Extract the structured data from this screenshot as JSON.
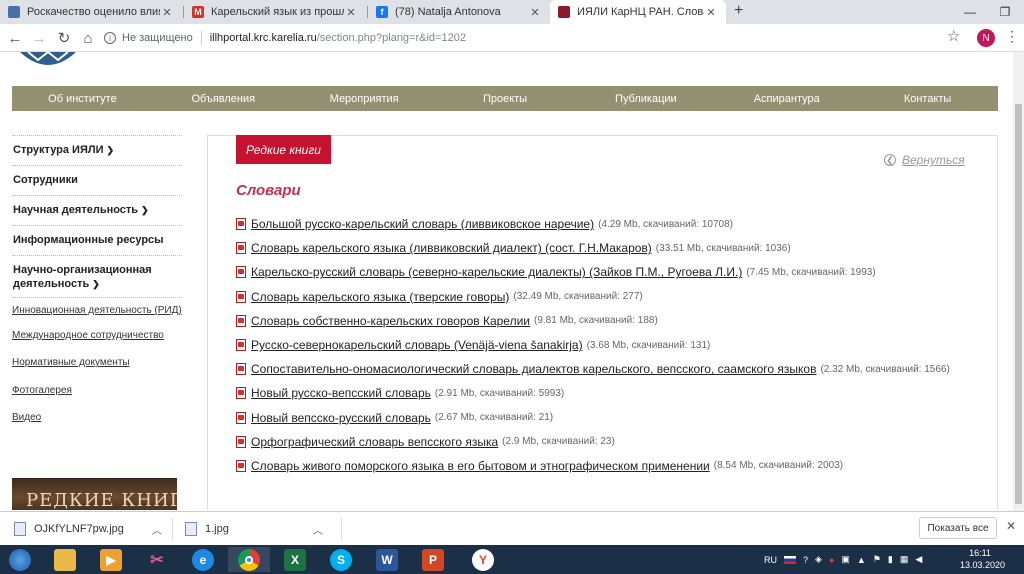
{
  "tabs": [
    {
      "title": "Роскачество оценило влияние",
      "favicon_color": "#4a6fa5",
      "active": false
    },
    {
      "title": "Карельский язык из прошлого",
      "favicon_color": "#d93025",
      "active": false
    },
    {
      "title": "(78) Natalja Antonova",
      "favicon_color": "#1877f2",
      "active": false
    },
    {
      "title": "ИЯЛИ КарНЦ РАН. Словари",
      "favicon_color": "#8b1a2c",
      "active": true
    }
  ],
  "address": {
    "security": "Не защищено",
    "domain": "illhportal.krc.karelia.ru",
    "path": "/section.php?plang=r&id=1202"
  },
  "profile_initial": "N",
  "main_nav": [
    "Об институте",
    "Объявления",
    "Мероприятия",
    "Проекты",
    "Публикации",
    "Аспирантура",
    "Контакты"
  ],
  "sidebar": {
    "main": [
      {
        "label": "Структура ИЯЛИ",
        "has_dropdown": true
      },
      {
        "label": "Сотрудники",
        "has_dropdown": false
      },
      {
        "label": "Научная деятельность",
        "has_dropdown": true
      },
      {
        "label": "Информационные ресурсы",
        "has_dropdown": false
      },
      {
        "label": "Научно-организационная деятельность",
        "has_dropdown": true
      }
    ],
    "sub": [
      "Инновационная деятельность (РИД)",
      "Международное сотрудничество",
      "Нормативные документы",
      "Фотогалерея",
      "Видео"
    ],
    "banner_text": "РЕДКИЕ КНИГИ"
  },
  "content": {
    "tag": "Редкие книги",
    "back_label": "Вернуться",
    "heading": "Словари",
    "files": [
      {
        "name": "Большой русско-карельский словарь (ливвиковское наречие)",
        "meta": "(4.29 Mb, скачиваний: 10708)"
      },
      {
        "name": "Словарь карельского языка (ливвиковский диалект) (сост. Г.Н.Макаров)",
        "meta": "(33.51 Mb, скачиваний: 1036)"
      },
      {
        "name": "Карельско-русский словарь (северно-карельские диалекты) (Зайков П.М., Ругоева Л.И.)",
        "meta": "(7.45 Mb, скачиваний: 1993)"
      },
      {
        "name": "Словарь карельского языка (тверские говоры)",
        "meta": "(32.49 Mb, скачиваний: 277)"
      },
      {
        "name": "Словарь собственно-карельских говоров Карелии",
        "meta": "(9.81 Mb, скачиваний: 188)"
      },
      {
        "name": "Русско-севернокарельский словарь (Venäjä-viena šanakirja)",
        "meta": "(3.68 Mb, скачиваний: 131)"
      },
      {
        "name": "Сопоставительно-ономасиологический словарь диалектов карельского, вепсского, саамского языков",
        "meta": "(2.32 Mb, скачиваний: 1566)"
      },
      {
        "name": "Новый русско-вепсский словарь",
        "meta": "(2.91 Mb, скачиваний: 5993)"
      },
      {
        "name": "Новый вепсско-русский словарь",
        "meta": "(2.67 Mb, скачиваний: 21)"
      },
      {
        "name": "Орфографический словарь вепсского языка",
        "meta": "(2.9 Mb, скачиваний: 23)"
      },
      {
        "name": "Словарь живого поморского языка в его бытовом и этнографическом применении",
        "meta": "(8.54 Mb, скачиваний: 2003)"
      }
    ]
  },
  "downloads": [
    {
      "file": "OJKfYLNF7pw.jpg"
    },
    {
      "file": "1.jpg"
    }
  ],
  "show_all": "Показать все",
  "taskbar": {
    "lang": "RU",
    "time": "16:11",
    "date": "13.03.2020"
  },
  "colors": {
    "nav_bg": "#949172",
    "accent_red": "#c41230",
    "heading": "#c0334d"
  }
}
